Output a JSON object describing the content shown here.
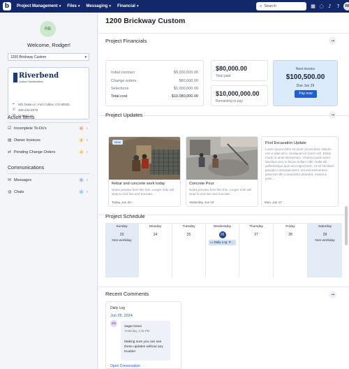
{
  "nav": {
    "logo": "b",
    "menu": [
      {
        "label": "Project Management"
      },
      {
        "label": "Files"
      },
      {
        "label": "Messaging"
      },
      {
        "label": "Financial"
      }
    ],
    "search_placeholder": "Search",
    "avatar": "RB"
  },
  "sidebar": {
    "avatar": "RB",
    "welcome": "Welcome, Rodger!",
    "project_select": "1200 Brickway Custom",
    "company": {
      "name": "Riverbend",
      "tagline": "Custom Homebuilders",
      "address": "001 Duke Ln, Fort Collins, CO 80525",
      "phone": "469-444-4578",
      "contact": "Contact us"
    },
    "action_items_title": "Action Items",
    "action_items": [
      {
        "label": "Incomplete To-Do's",
        "count": "6"
      },
      {
        "label": "Owner Invoices",
        "count": "2"
      },
      {
        "label": "Pending Change Orders",
        "count": "4"
      }
    ],
    "communications_title": "Communications",
    "communications": [
      {
        "label": "Messages",
        "count": "6"
      },
      {
        "label": "Chats",
        "count": "4"
      }
    ]
  },
  "main": {
    "title": "1200 Brickway Custom",
    "financials": {
      "title": "Project Financials",
      "rows": [
        {
          "label": "Initial contract",
          "value": "$9,000,000.00"
        },
        {
          "label": "Change orders",
          "value": "$80,000.00"
        },
        {
          "label": "Selections",
          "value": "$1,000,000.00"
        },
        {
          "label": "Total cost",
          "value": "$10,080,000.00"
        }
      ],
      "total_paid_value": "$80,000.00",
      "total_paid_label": "Total paid",
      "remaining_value": "$10,000,000.00",
      "remaining_label": "Remaining to pay",
      "next_invoice_label": "Next invoice",
      "next_invoice_value": "$100,500.00",
      "next_invoice_due": "Due Jun 29",
      "pay_button": "Pay now"
    },
    "updates": {
      "title": "Project Updates",
      "new_tag": "New",
      "cards": [
        {
          "title": "Rebar and concrete work today",
          "preview": "Notes preview here like this. Longer note will wrap to 2nd line and truncate...",
          "date": "Today, Jun 20"
        },
        {
          "title": "Concrete Pour",
          "preview": "Notes preview here like this. Longer note will wrap to 2nd line and truncate...",
          "date": "Yesterday, Jun 19"
        },
        {
          "title": "Pool Excavation Update",
          "preview": "Lorem ipsum dolor sit amet consectetur. Mauris nec a vitae arcu. Id aliquam in lorem nisl. Etiam morbi ut amet elementum. Vivamus justo tortor faucibus arcu in lectus nullam nibh. Nulla elit pellentesque quis arcu eget lorem. Ut sit tincidunt gravida consequat amet. Vel erat elementum placerat nibh consectetur pharetra. Vivamus justo...",
          "date": "Mon, Jun 17"
        }
      ]
    },
    "schedule": {
      "title": "Project Schedule",
      "days": [
        {
          "name": "Sunday",
          "num": "23",
          "note": "Non-workday",
          "shaded": true
        },
        {
          "name": "Monday",
          "num": "24",
          "note": "",
          "shaded": false
        },
        {
          "name": "Tuesday",
          "num": "25",
          "note": "",
          "shaded": false
        },
        {
          "name": "Wednesday",
          "num": "26",
          "note": "",
          "shaded": false,
          "today": true
        },
        {
          "name": "Thursday",
          "num": "27",
          "note": "",
          "shaded": false
        },
        {
          "name": "Friday",
          "num": "28",
          "note": "",
          "shaded": false
        },
        {
          "name": "Saturday",
          "num": "29",
          "note": "Non-workday",
          "shaded": true
        }
      ],
      "event": "Daily Log: P..."
    },
    "comments": {
      "title": "Recent Comments",
      "card_label": "Daily Log",
      "date": "Jun 26, 2024",
      "author_initials": "SD",
      "author": "Sagar Desai",
      "time": "Yesterday, 2:15 PM",
      "message": "Making sure you can see these updates without any trouble!",
      "open_link": "Open Conversation"
    }
  }
}
